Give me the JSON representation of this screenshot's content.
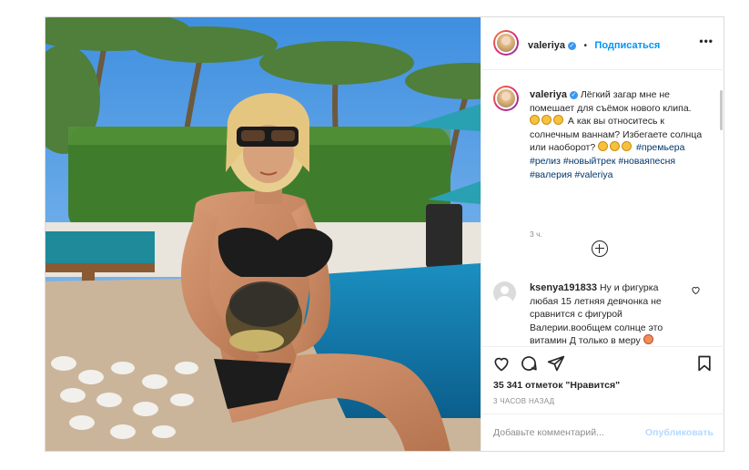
{
  "post": {
    "username": "valeriya",
    "follow_label": "Подписаться",
    "more_label": "•••",
    "dot": "•",
    "caption_text_1": "Лёгкий загар мне не помешает для съёмок нового клипа.",
    "caption_text_2": "А как вы относитесь к солнечным ваннам? Избегаете солнца или наоборот?",
    "hashtags": [
      "#премьера",
      "#релиз",
      "#новыйтрек",
      "#новаяпесня",
      "#валерия",
      "#valeriya"
    ],
    "time_ago": "3 ч.",
    "comment": {
      "username": "ksenya191833",
      "text": "Ну и фигурка любая 15 летняя девчонка не сравнится с фигурой Валерии.вообщем солнце это витамин Д только в меру"
    },
    "likes": "35 341 отметок \"Нравится\"",
    "posted_ago": "3 ЧАСОВ НАЗАД",
    "add_comment_placeholder": "Добавьте комментарий...",
    "publish_label": "Опубликовать"
  },
  "icons": [
    "heart-icon",
    "comment-icon",
    "share-icon",
    "bookmark-icon",
    "verified-badge-icon",
    "load-more-icon",
    "like-comment-icon"
  ],
  "colors": {
    "accent": "#0095f6",
    "hashtag": "#00376b",
    "muted": "#8e8e8e",
    "border": "#dbdbdb"
  }
}
